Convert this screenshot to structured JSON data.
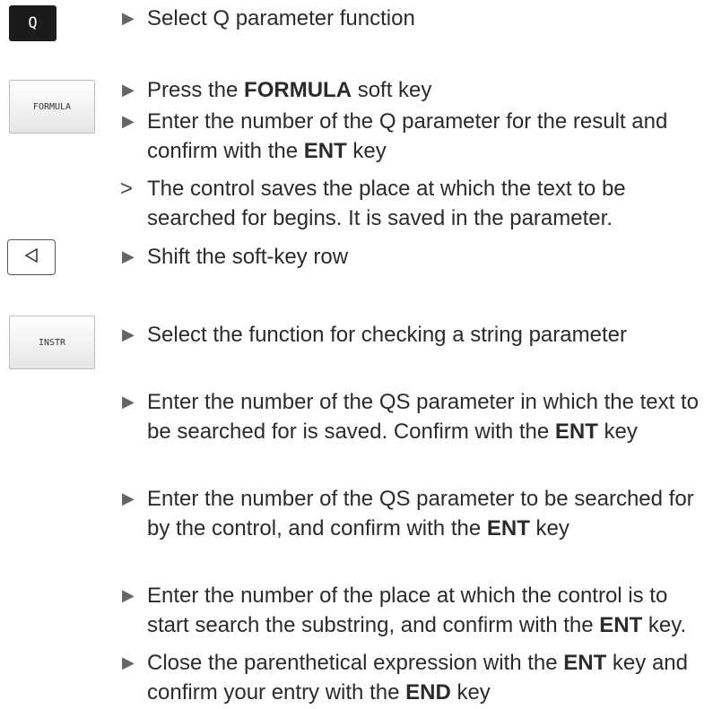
{
  "keys": {
    "q_key": "Q",
    "formula_key": "FORMULA",
    "instr_key": "INSTR"
  },
  "markers": {
    "step": "▶",
    "result": ">"
  },
  "steps": [
    {
      "text": "Select Q parameter function"
    },
    {
      "before": "Press the ",
      "bold": "FORMULA",
      "after": " soft key"
    },
    {
      "before": "Enter the number of the Q parameter for the result and confirm with the ",
      "bold": "ENT",
      "after": " key"
    },
    {
      "text": "The control saves the place at which the text to be searched for begins. It is saved in the parameter."
    },
    {
      "text": "Shift the soft-key row"
    },
    {
      "text": "Select the function for checking a string parameter"
    },
    {
      "before": "Enter the number of the QS parameter in which the text to be searched for is saved. Confirm with the ",
      "bold": "ENT",
      "after": " key"
    },
    {
      "before": "Enter the number of the QS parameter to be searched for by the control, and confirm with the ",
      "bold": "ENT",
      "after": " key"
    },
    {
      "before": "Enter the number of the place at which the control is to start search the substring, and confirm with the ",
      "bold": "ENT",
      "after": " key."
    },
    {
      "before": "Close the parenthetical expression with the ",
      "bold": "ENT",
      "mid": " key and confirm your entry with the ",
      "bold2": "END",
      "after": " key"
    }
  ]
}
